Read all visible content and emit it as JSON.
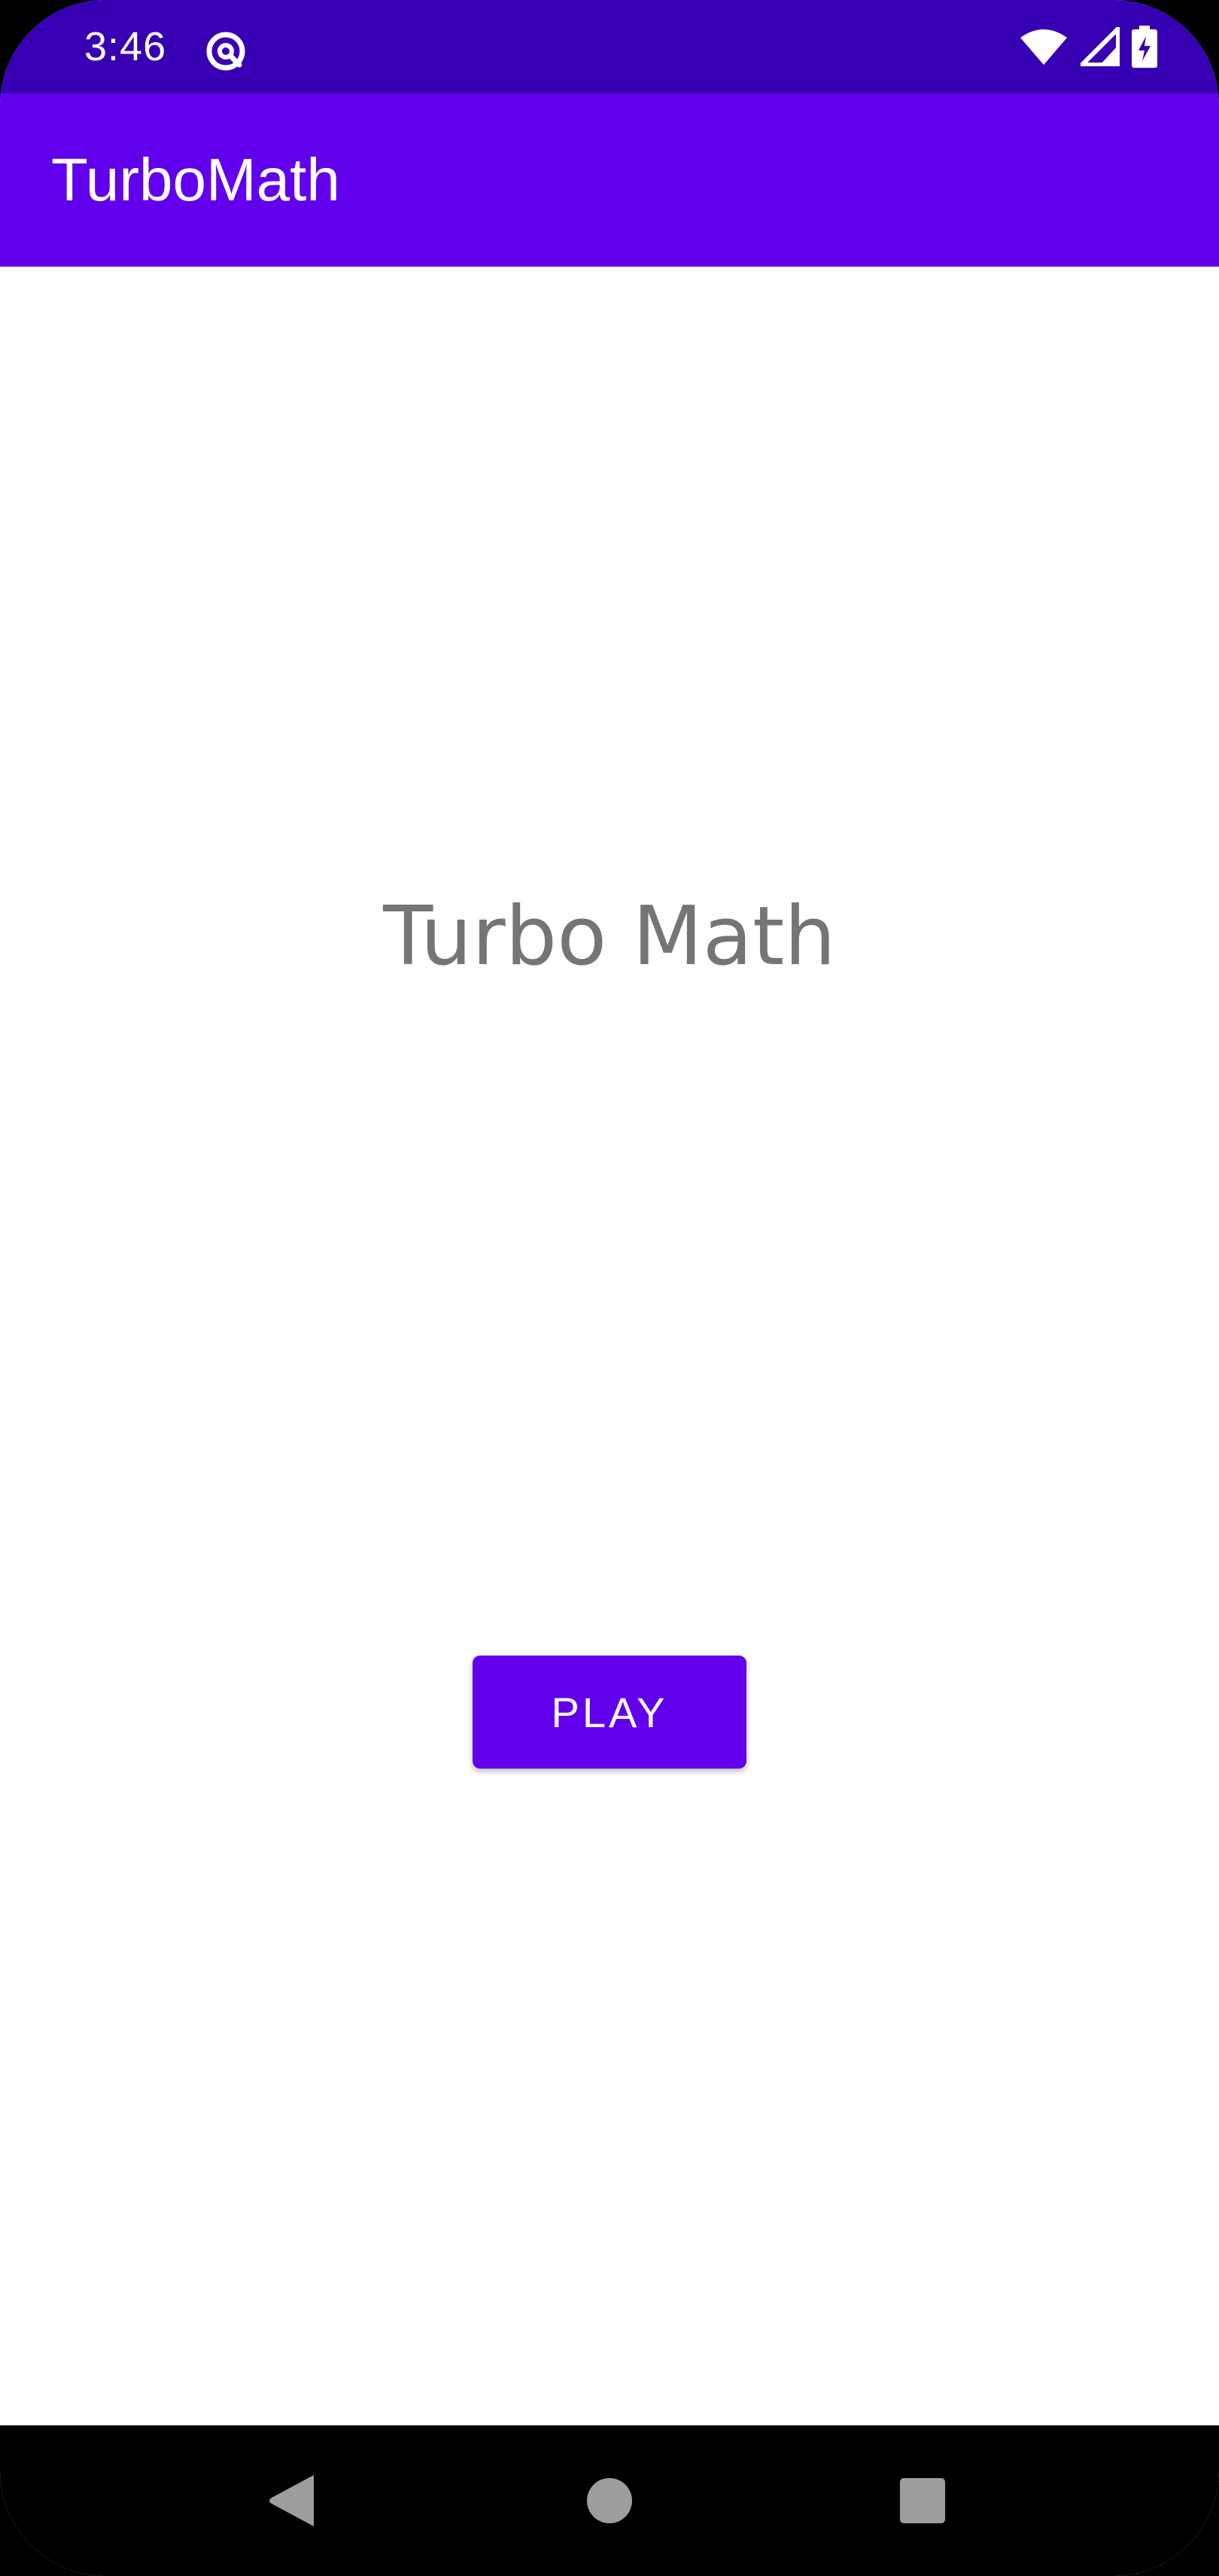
{
  "status_bar": {
    "time": "3:46",
    "notification_icon": "data-saver-icon",
    "icons": [
      "wifi-icon",
      "cellular-signal-icon",
      "battery-charging-icon"
    ],
    "background_color": "#3700b3"
  },
  "app_bar": {
    "title": "TurboMath",
    "background_color": "#6200ee"
  },
  "main": {
    "heading": "Turbo Math",
    "heading_color": "#757575",
    "play_button_label": "PLAY",
    "play_button_color": "#6200ee"
  },
  "nav_bar": {
    "items": [
      "back-icon",
      "home-icon",
      "recents-icon"
    ]
  }
}
